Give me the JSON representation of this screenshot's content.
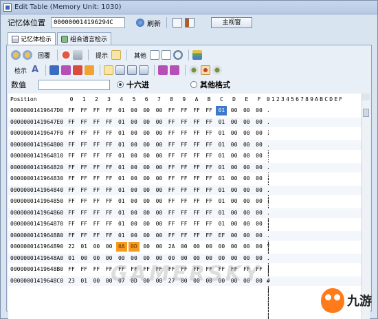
{
  "window": {
    "title": "Edit Table (Memory Unit: 1030)"
  },
  "toolbar": {
    "address_label": "记忆体位置",
    "address_value": "000000014196294C",
    "refresh_label": "刷新",
    "main_window_button": "主视窗"
  },
  "tabs": [
    {
      "label": "记忆体检示",
      "active": true
    },
    {
      "label": "组合语言检示",
      "active": false
    }
  ],
  "toolbar_row1": {
    "back_label": "回覆",
    "hint_label": "提示",
    "other_label": "其他"
  },
  "toolbar_row2": {
    "check_label": "检示"
  },
  "value_row": {
    "value_label": "数值",
    "radio_hex": "十六进",
    "radio_other": "其他格式",
    "selected": "hex"
  },
  "grid": {
    "position_header": "Position",
    "columns": [
      "0",
      "1",
      "2",
      "3",
      "4",
      "5",
      "6",
      "7",
      "8",
      "9",
      "A",
      "B",
      "C",
      "D",
      "E",
      "F"
    ],
    "ascii_header": "0123456789ABCDEF",
    "rows": [
      {
        "addr": "00000001419647D0",
        "bytes": [
          "FF",
          "FF",
          "FF",
          "FF",
          "01",
          "00",
          "00",
          "00",
          "FF",
          "FF",
          "FF",
          "FF",
          "01",
          "00",
          "00",
          "00"
        ],
        "ascii": ". . . . . . . . . . . . . . . ."
      },
      {
        "addr": "00000001419647E0",
        "bytes": [
          "FF",
          "FF",
          "FF",
          "FF",
          "01",
          "00",
          "00",
          "00",
          "FF",
          "FF",
          "FF",
          "FF",
          "01",
          "00",
          "00",
          "00"
        ],
        "ascii": ". . . . . . . . . . . . . . . ."
      },
      {
        "addr": "00000001419647F0",
        "bytes": [
          "FF",
          "FF",
          "FF",
          "FF",
          "01",
          "00",
          "00",
          "00",
          "FF",
          "FF",
          "FF",
          "FF",
          "01",
          "00",
          "00",
          "00"
        ],
        "ascii": ". . . . . . . . . . . . . . . ."
      },
      {
        "addr": "0000000141964800",
        "bytes": [
          "FF",
          "FF",
          "FF",
          "FF",
          "01",
          "00",
          "00",
          "00",
          "FF",
          "FF",
          "FF",
          "FF",
          "01",
          "00",
          "00",
          "00"
        ],
        "ascii": ". . . . . . . . . . . . . . . ."
      },
      {
        "addr": "0000000141964810",
        "bytes": [
          "FF",
          "FF",
          "FF",
          "FF",
          "01",
          "00",
          "00",
          "00",
          "FF",
          "FF",
          "FF",
          "FF",
          "01",
          "00",
          "00",
          "00"
        ],
        "ascii": ". . . . . . . . . . . . . . . ."
      },
      {
        "addr": "0000000141964820",
        "bytes": [
          "FF",
          "FF",
          "FF",
          "FF",
          "01",
          "00",
          "00",
          "00",
          "FF",
          "FF",
          "FF",
          "FF",
          "01",
          "00",
          "00",
          "00"
        ],
        "ascii": ". . . . . . . . . . . . . . . ."
      },
      {
        "addr": "0000000141964830",
        "bytes": [
          "FF",
          "FF",
          "FF",
          "FF",
          "01",
          "00",
          "00",
          "00",
          "FF",
          "FF",
          "FF",
          "FF",
          "01",
          "00",
          "00",
          "00"
        ],
        "ascii": ". . . . . . . . . . . . . . . ."
      },
      {
        "addr": "0000000141964840",
        "bytes": [
          "FF",
          "FF",
          "FF",
          "FF",
          "01",
          "00",
          "00",
          "00",
          "FF",
          "FF",
          "FF",
          "FF",
          "01",
          "00",
          "00",
          "00"
        ],
        "ascii": ". . . . . . . . . . . . . . . ."
      },
      {
        "addr": "0000000141964850",
        "bytes": [
          "FF",
          "FF",
          "FF",
          "FF",
          "01",
          "00",
          "00",
          "00",
          "FF",
          "FF",
          "FF",
          "FF",
          "01",
          "00",
          "00",
          "00"
        ],
        "ascii": ". . . . . . . . . . . . . . . ."
      },
      {
        "addr": "0000000141964860",
        "bytes": [
          "FF",
          "FF",
          "FF",
          "FF",
          "01",
          "00",
          "00",
          "00",
          "FF",
          "FF",
          "FF",
          "FF",
          "01",
          "00",
          "00",
          "00"
        ],
        "ascii": ". . . . . . . . . . . . . . . ."
      },
      {
        "addr": "0000000141964870",
        "bytes": [
          "FF",
          "FF",
          "FF",
          "FF",
          "01",
          "00",
          "00",
          "00",
          "FF",
          "FF",
          "FF",
          "FF",
          "01",
          "00",
          "00",
          "00"
        ],
        "ascii": ". . . . . . . . . . . . . . . ."
      },
      {
        "addr": "0000000141964880",
        "bytes": [
          "FF",
          "FF",
          "FF",
          "FF",
          "01",
          "00",
          "00",
          "00",
          "FF",
          "FF",
          "FF",
          "FF",
          "EF",
          "00",
          "00",
          "00"
        ],
        "ascii": ". . . . . . . . . . . . . . . ."
      },
      {
        "addr": "0000000141964890",
        "bytes": [
          "22",
          "01",
          "00",
          "00",
          "0A",
          "0D",
          "00",
          "00",
          "2A",
          "00",
          "00",
          "00",
          "00",
          "00",
          "00",
          "00"
        ],
        "ascii": "\" . . . . . . . * . . . . . . ."
      },
      {
        "addr": "00000001419648A0",
        "bytes": [
          "01",
          "00",
          "00",
          "00",
          "00",
          "00",
          "00",
          "00",
          "00",
          "00",
          "00",
          "00",
          "00",
          "00",
          "00",
          "00"
        ],
        "ascii": ". . . . . . . . . . . . . . . ."
      },
      {
        "addr": "00000001419648B0",
        "bytes": [
          "FF",
          "FF",
          "FF",
          "FF",
          "FF",
          "FF",
          "FF",
          "FF",
          "FF",
          "FF",
          "FF",
          "FF",
          "FF",
          "FF",
          "FF",
          "FF"
        ],
        "ascii": ". . . . . . . . . . . . . . . ."
      },
      {
        "addr": "00000001419648C0",
        "bytes": [
          "23",
          "01",
          "00",
          "00",
          "07",
          "0D",
          "00",
          "00",
          "27",
          "00",
          "00",
          "00",
          "00",
          "00",
          "00",
          "00"
        ],
        "ascii": "# . . . . . . . ' . . . . . . ."
      }
    ],
    "highlight_blue": {
      "row": 0,
      "col": 12
    },
    "highlight_orange": [
      {
        "row": 12,
        "col": 4
      },
      {
        "row": 12,
        "col": 5
      }
    ]
  },
  "watermark": "GAMERSKY",
  "logo_text": "九游"
}
